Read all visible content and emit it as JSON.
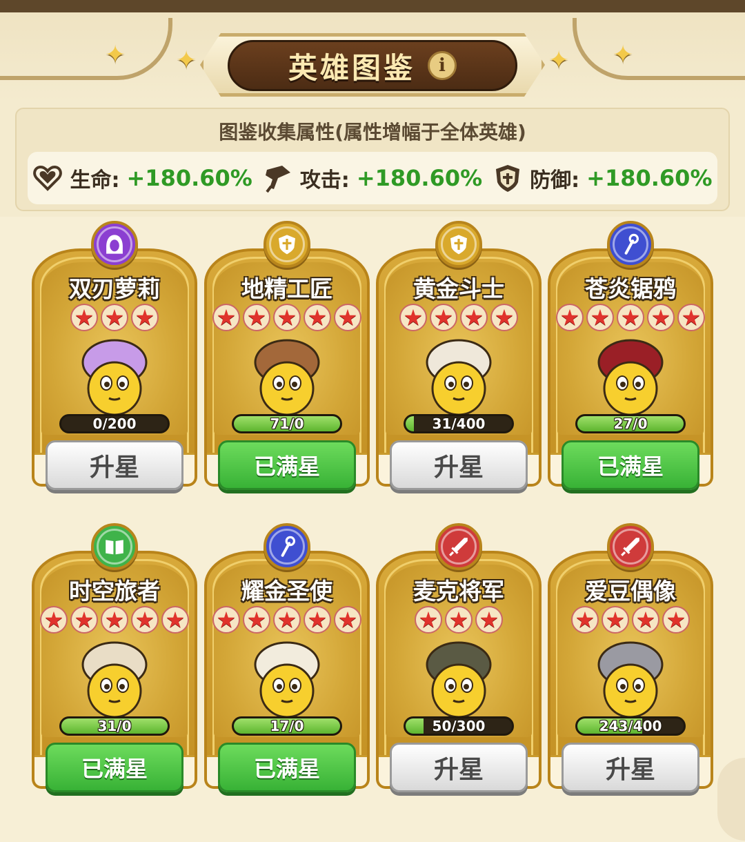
{
  "header": {
    "title": "英雄图鉴",
    "info_icon": "i"
  },
  "collection": {
    "title": "图鉴收集属性(属性增幅于全体英雄)",
    "stats": [
      {
        "label": "生命:",
        "value": "+180.60%",
        "icon": "heart-icon"
      },
      {
        "label": "攻击:",
        "value": "+180.60%",
        "icon": "sword-icon"
      },
      {
        "label": "防御:",
        "value": "+180.60%",
        "icon": "shield-icon"
      }
    ]
  },
  "heroes": [
    {
      "name": "双刃萝莉",
      "stars": 3,
      "progress": "0/200",
      "fill": 0,
      "button": "升星",
      "button_style": "gray",
      "class_icon": "hood-icon",
      "badge_color": "#8b3fd1",
      "hair": "#c79be8"
    },
    {
      "name": "地精工匠",
      "stars": 5,
      "progress": "71/0",
      "fill": 1,
      "button": "已满星",
      "button_style": "green",
      "class_icon": "shield-class-icon",
      "badge_color": "#d9a92c",
      "hair": "#a3683a"
    },
    {
      "name": "黄金斗士",
      "stars": 4,
      "progress": "31/400",
      "fill": 0.08,
      "button": "升星",
      "button_style": "gray",
      "class_icon": "shield-class-icon",
      "badge_color": "#d9a92c",
      "hair": "#efe8da"
    },
    {
      "name": "苍炎锯鸦",
      "stars": 5,
      "progress": "27/0",
      "fill": 1,
      "button": "已满星",
      "button_style": "green",
      "class_icon": "staff-icon",
      "badge_color": "#3f4fd1",
      "hair": "#9a1f26"
    },
    {
      "name": "时空旅者",
      "stars": 5,
      "progress": "31/0",
      "fill": 1,
      "button": "已满星",
      "button_style": "green",
      "class_icon": "book-icon",
      "badge_color": "#3fb34a",
      "hair": "#e9ddc6"
    },
    {
      "name": "耀金圣使",
      "stars": 5,
      "progress": "17/0",
      "fill": 1,
      "button": "已满星",
      "button_style": "green",
      "class_icon": "staff-icon",
      "badge_color": "#3f4fd1",
      "hair": "#f2ecdd"
    },
    {
      "name": "麦克将军",
      "stars": 3,
      "progress": "50/300",
      "fill": 0.17,
      "button": "升星",
      "button_style": "gray",
      "class_icon": "sword-class-icon",
      "badge_color": "#cf3b3b",
      "hair": "#5a5a44"
    },
    {
      "name": "爱豆偶像",
      "stars": 4,
      "progress": "243/400",
      "fill": 0.61,
      "button": "升星",
      "button_style": "gray",
      "class_icon": "sword-class-icon",
      "badge_color": "#cf3b3b",
      "hair": "#9a9aa2"
    }
  ],
  "colors": {
    "gold_card": "#d8a93a",
    "stat_green": "#2f9a25",
    "star_red": "#e0332c"
  }
}
